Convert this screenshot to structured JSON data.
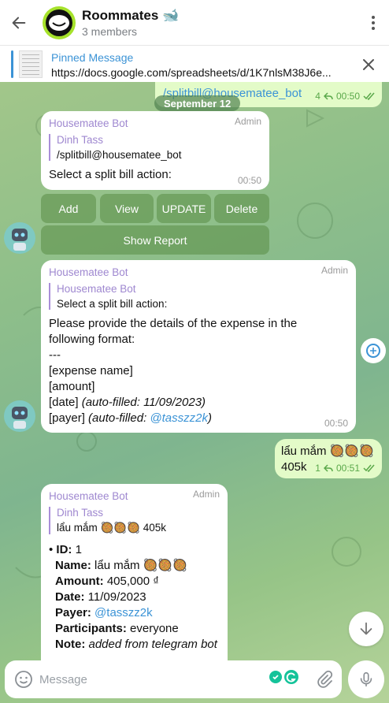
{
  "header": {
    "back_icon": "arrow-left-icon",
    "title": "Roommates 🐋",
    "subtitle": "3 members",
    "avatar_color": "#a6e22b"
  },
  "pinned": {
    "title": "Pinned Message",
    "text": "https://docs.google.com/spreadsheets/d/1K7nlsM38J6e..."
  },
  "outgoing_top": {
    "text": "/splitbill@housematee_bot",
    "count": "4",
    "time": "00:50"
  },
  "date_chip": "September 12",
  "msg1": {
    "sender": "Housematee Bot",
    "badge": "Admin",
    "reply_name": "Dinh Tass",
    "reply_text": "/splitbill@housematee_bot",
    "text": "Select a split bill action:",
    "time": "00:50"
  },
  "keyboard": {
    "add": "Add",
    "view": "View",
    "update": "UPDATE",
    "delete": "Delete",
    "report": "Show Report"
  },
  "msg2": {
    "sender": "Housematee Bot",
    "badge": "Admin",
    "reply_name": "Housematee Bot",
    "reply_text": "Select a split bill action:",
    "line1": "Please provide the details of the expense in the",
    "line2": "following format:",
    "line3": "---",
    "line4": "[expense name]",
    "line5": "[amount]",
    "line6a": "[date] ",
    "line6b": "(auto-filled: 11/09/2023)",
    "line7a": "[payer] ",
    "line7b": "(auto-filled: ",
    "line7c": "@tasszz2k",
    "line7d": ")",
    "time": "00:50"
  },
  "msg3": {
    "line1": "lẩu mắm 🥘🥘🥘",
    "line2": "405k",
    "count": "1",
    "time": "00:51"
  },
  "msg4": {
    "sender": "Housematee Bot",
    "badge": "Admin",
    "reply_name": "Dinh Tass",
    "reply_text": "lẩu mắm 🥘🥘🥘 405k",
    "id_label": "ID:",
    "id_value": " 1",
    "name_label": "Name:",
    "name_value": " lẩu mắm 🥘🥘🥘",
    "amount_label": "Amount:",
    "amount_value": " 405,000 ₫",
    "date_label": "Date:",
    "date_value": " 11/09/2023",
    "payer_label": "Payer:",
    "payer_value": "@tasszz2k",
    "participants_label": "Participants:",
    "participants_value": " everyone",
    "note_label": "Note:",
    "note_value": "added from telegram bot"
  },
  "composer": {
    "placeholder": "Message"
  }
}
